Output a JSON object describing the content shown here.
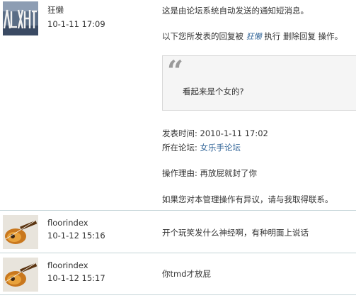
{
  "messages": [
    {
      "username": "狂懒",
      "time": "10-1-11 17:09",
      "notice": "这是由论坛系统自动发送的通知短消息。",
      "action_prefix": "以下您所发表的回复被",
      "operator": "狂懒",
      "action_exec": "执行",
      "action_name": "删除回复",
      "action_suffix": "操作。",
      "quote_text": "看起来是个女的?",
      "post_time_label": "发表时间:",
      "post_time": "2010-1-11 17:02",
      "forum_label": "所在论坛:",
      "forum_name": "女乐手论坛",
      "reason_label": "操作理由:",
      "reason": "再放屁就封了你",
      "contact": "如果您对本管理操作有异议，请与我取得联系。"
    },
    {
      "username": "floorindex",
      "time": "10-1-12 15:16",
      "text": "开个玩笑发什么神经啊，有种明面上说话"
    },
    {
      "username": "floorindex",
      "time": "10-1-12 15:17",
      "text": "你tmd才放屁"
    }
  ],
  "colors": {
    "link": "#336699",
    "divider": "#c5d5d8",
    "quote_bg": "#f5f5f5"
  }
}
